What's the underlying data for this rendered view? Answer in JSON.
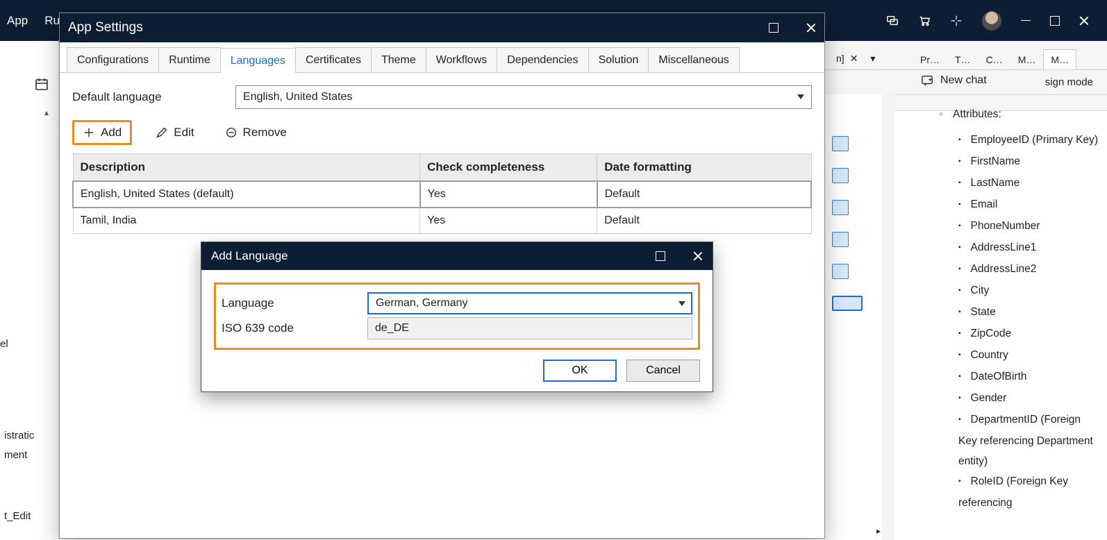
{
  "topbar": {
    "menu": [
      "App",
      "Ru"
    ],
    "icons": [
      "chat-bubbles-icon",
      "cart-icon",
      "sparkle-icon"
    ]
  },
  "settings": {
    "title": "App Settings",
    "tabs": [
      "Configurations",
      "Runtime",
      "Languages",
      "Certificates",
      "Theme",
      "Workflows",
      "Dependencies",
      "Solution",
      "Miscellaneous"
    ],
    "active_tab": "Languages",
    "default_lang_label": "Default language",
    "default_lang_value": "English, United States",
    "toolbar": {
      "add": "Add",
      "edit": "Edit",
      "remove": "Remove"
    },
    "table": {
      "headers": [
        "Description",
        "Check completeness",
        "Date formatting"
      ],
      "rows": [
        {
          "desc": "English, United States (default)",
          "check": "Yes",
          "date": "Default"
        },
        {
          "desc": "Tamil, India",
          "check": "Yes",
          "date": "Default"
        }
      ]
    }
  },
  "add_lang": {
    "title": "Add Language",
    "lang_label": "Language",
    "lang_value": "German, Germany",
    "iso_label": "ISO 639 code",
    "iso_value": "de_DE",
    "ok": "OK",
    "cancel": "Cancel"
  },
  "behind": {
    "tab_suffix": "n]",
    "mode": "sign mode"
  },
  "right_tabs": [
    "Pr…",
    "T…",
    "C…",
    "M…",
    "M…"
  ],
  "chat_new": "New chat",
  "attributes": {
    "header": "Attributes:",
    "items": [
      "EmployeeID (Primary Key)",
      "FirstName",
      "LastName",
      "Email",
      "PhoneNumber",
      "AddressLine1",
      "AddressLine2",
      "City",
      "State",
      "ZipCode",
      "Country",
      "DateOfBirth",
      "Gender",
      "DepartmentID (Foreign Key referencing Department entity)",
      "RoleID (Foreign Key referencing"
    ]
  },
  "left_items": [
    "el",
    "istratic",
    "ment",
    "t_Edit"
  ]
}
